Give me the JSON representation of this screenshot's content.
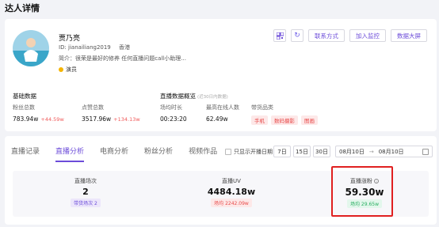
{
  "page": {
    "title": "达人详情"
  },
  "profile": {
    "name": "贾乃亮",
    "id_text": "ID: jianailiang2019",
    "location": "香港",
    "bio": "简介：很荣是最好的修养 任何直播问题call小助理...",
    "tag": "演员"
  },
  "actions": {
    "icon_1": "qrcode-icon",
    "icon_2": "refresh-icon",
    "contact": "联系方式",
    "monitor": "加入监控",
    "big_screen": "数据大屏"
  },
  "basic": {
    "title": "基础数据",
    "fans_label": "粉丝总数",
    "fans_value": "783.94w",
    "fans_change": "+44.59w",
    "likes_label": "点赞总数",
    "likes_value": "3517.96w",
    "likes_change": "+134.13w"
  },
  "live_overview": {
    "title": "直播数据概览",
    "note": "(近30日内数据)",
    "duration_label": "场均时长",
    "duration_value": "00:23:20",
    "peak_label": "最高在线人数",
    "peak_value": "62.49w",
    "category_label": "带货品类",
    "categories": [
      "手机",
      "数码摄影",
      "图画"
    ]
  },
  "tabs": [
    "直播记录",
    "直播分析",
    "电商分析",
    "粉丝分析",
    "视频作品"
  ],
  "filters": {
    "checkbox_label": "只显示开播日期",
    "ranges": [
      "7日",
      "15日",
      "30日"
    ],
    "date_start": "08月10日",
    "date_end": "08月10日"
  },
  "metrics": {
    "sessions_label": "直播场次",
    "sessions_value": "2",
    "sessions_sub": "带货场次 2",
    "uv_label": "直播UV",
    "uv_value": "4484.18w",
    "uv_sub": "场均 2242.09w",
    "fans_label": "直播涨粉",
    "fans_value": "59.30w",
    "fans_sub": "场均 29.65w"
  },
  "colors": {
    "accent": "#6c4cd9",
    "highlight": "#e02020",
    "up": "#f05a5a"
  }
}
